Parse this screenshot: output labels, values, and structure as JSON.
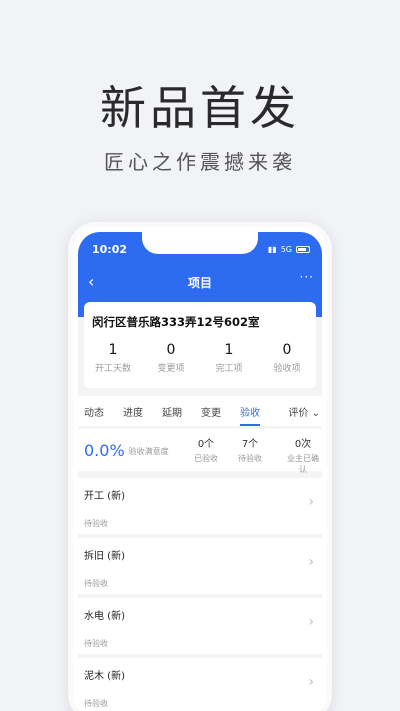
{
  "hero": {
    "headline": "新品首发",
    "tagline": "匠心之作震撼来袭"
  },
  "phone": {
    "status": {
      "time": "10:02",
      "network": "5G"
    },
    "nav": {
      "title": "项目",
      "more": "···"
    },
    "project": {
      "address": "闵行区普乐路333弄12号602室",
      "stats": [
        {
          "value": "1",
          "label": "开工天数"
        },
        {
          "value": "0",
          "label": "变更项"
        },
        {
          "value": "1",
          "label": "完工项"
        },
        {
          "value": "0",
          "label": "验收项"
        }
      ]
    },
    "tabs": [
      "动态",
      "进度",
      "延期",
      "变更",
      "验收"
    ],
    "tab_more": "评价",
    "active_tab": "验收",
    "summary": {
      "percent": "0.0%",
      "percent_label": "验收满意度",
      "items": [
        {
          "value": "0个",
          "label": "已验收"
        },
        {
          "value": "7个",
          "label": "待验收"
        },
        {
          "value": "0次",
          "label": "业主已确认"
        }
      ]
    },
    "items": [
      {
        "name": "开工 (新)",
        "status": "待验收"
      },
      {
        "name": "拆旧 (新)",
        "status": "待验收"
      },
      {
        "name": "水电 (新)",
        "status": "待验收"
      },
      {
        "name": "泥木 (新)",
        "status": "待验收"
      }
    ],
    "colors": {
      "accent": "#2d6cf0"
    }
  }
}
